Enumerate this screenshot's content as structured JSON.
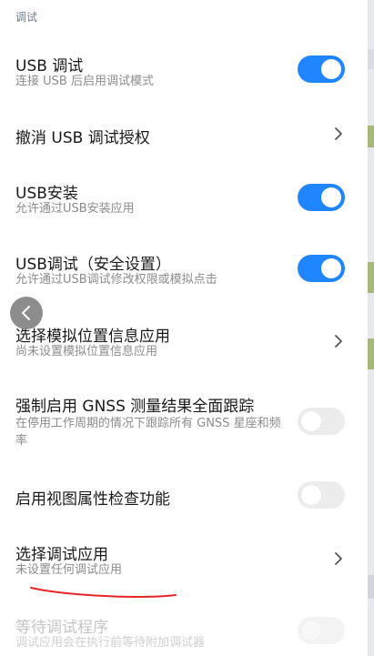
{
  "section_header": "调试",
  "settings": [
    {
      "title": "USB 调试",
      "subtitle": "连接 USB 后启用调试模式",
      "control": "toggle",
      "state": "on"
    },
    {
      "title": "撤消 USB 调试授权",
      "control": "chevron"
    },
    {
      "title": "USB安装",
      "subtitle": "允许通过USB安装应用",
      "control": "toggle",
      "state": "on"
    },
    {
      "title": "USB调试（安全设置）",
      "subtitle": "允许通过USB调试修改权限或模拟点击",
      "control": "toggle",
      "state": "on"
    },
    {
      "title": "选择模拟位置信息应用",
      "subtitle": "尚未设置模拟位置信息应用",
      "control": "chevron"
    },
    {
      "title": "强制启用 GNSS 测量结果全面跟踪",
      "subtitle": "在停用工作周期的情况下跟踪所有 GNSS 星座和频率",
      "control": "toggle",
      "state": "off"
    },
    {
      "title": "启用视图属性检查功能",
      "control": "toggle",
      "state": "off"
    },
    {
      "title": "选择调试应用",
      "subtitle": "未设置任何调试应用",
      "control": "chevron"
    },
    {
      "title": "等待调试程序",
      "subtitle": "调试应用会在执行前等待附加调试器",
      "control": "toggle",
      "state": "off",
      "disabled": true
    }
  ],
  "icons": {
    "back": "chevron-left-icon",
    "chevron": "chevron-right-icon"
  },
  "colors": {
    "accent": "#1f86ff",
    "annotation": "#e8262a"
  }
}
